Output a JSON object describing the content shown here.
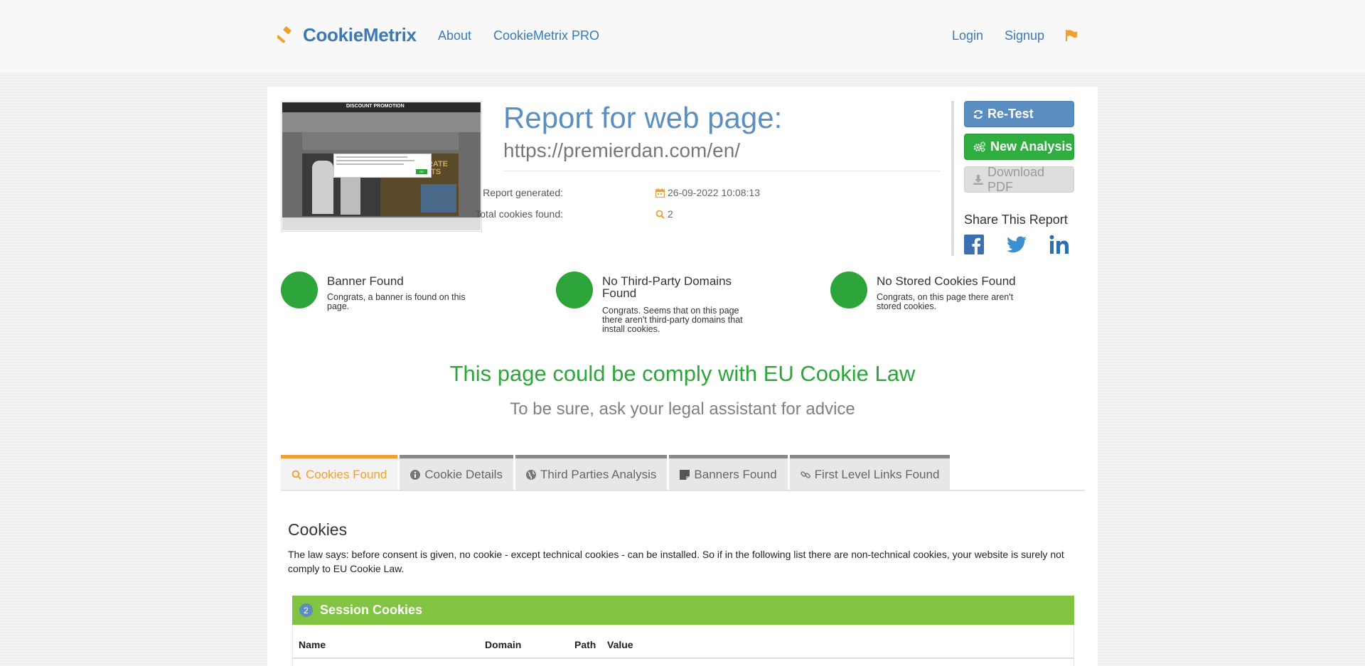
{
  "nav": {
    "brand": "CookieMetrix",
    "about": "About",
    "pro": "CookieMetrix PRO",
    "login": "Login",
    "signup": "Signup"
  },
  "report": {
    "title": "Report for web page:",
    "url": "https://premierdan.com/en/",
    "generated_label": "Report generated:",
    "generated_value": "26-09-2022 10:08:13",
    "total_label": "Total cookies found:",
    "total_value": "2"
  },
  "thumbnail": {
    "promo_text": "DISCOUNT PROMOTION",
    "banner_text": "KARATE BELTS",
    "popup_button": "OK"
  },
  "actions": {
    "retest": "Re-Test",
    "new_analysis": "New Analysis",
    "download_pdf": "Download PDF",
    "share_title": "Share This Report"
  },
  "checks": [
    {
      "title": "Banner Found",
      "desc": "Congrats, a banner is found on this page."
    },
    {
      "title": "No Third-Party Domains Found",
      "desc": "Congrats. Seems that on this page there aren't third-party domains that install cookies."
    },
    {
      "title": "No Stored Cookies Found",
      "desc": "Congrats, on this page there aren't stored cookies."
    }
  ],
  "verdict": {
    "comply": "This page could be comply with EU Cookie Law",
    "advice": "To be sure, ask your legal assistant for advice"
  },
  "tabs": [
    {
      "label": "Cookies Found"
    },
    {
      "label": "Cookie Details"
    },
    {
      "label": "Third Parties Analysis"
    },
    {
      "label": "Banners Found"
    },
    {
      "label": "First Level Links Found"
    }
  ],
  "cookies": {
    "title": "Cookies",
    "text": "The law says: before consent is given, no cookie - except technical cookies - can be installed. So if in the following list there are non-technical cookies, your website is surely not comply to EU Cookie Law.",
    "session_count": "2",
    "session_title": "Session Cookies",
    "columns": [
      "Name",
      "Domain",
      "Path",
      "Value"
    ]
  },
  "colors": {
    "brand": "#3b7ab5",
    "accent": "#f0a030",
    "success": "#2ea53a",
    "session_bar": "#82c341"
  }
}
